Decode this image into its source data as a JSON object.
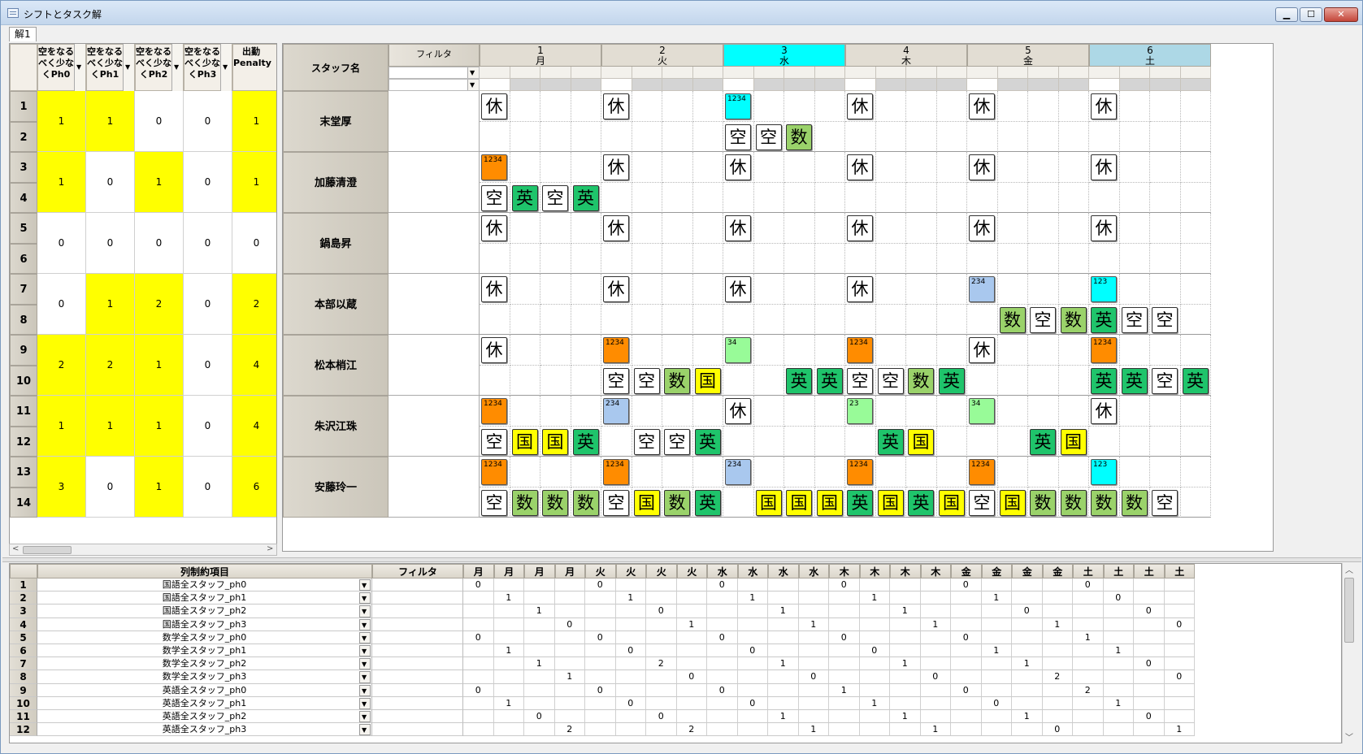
{
  "window": {
    "title": "シフトとタスク解",
    "min": "▁",
    "max": "☐",
    "close": "✕",
    "icons": [
      "app-icon",
      "minimize-icon",
      "maximize-icon",
      "close-icon"
    ]
  },
  "tabs": [
    {
      "label": "解1"
    }
  ],
  "left": {
    "headers": [
      "空をなるべく少なくPh0",
      "空をなるべく少なくPh1",
      "空をなるべく少なくPh2",
      "空をなるべく少なくPh3",
      "出勤Penalty"
    ],
    "rownums": [
      "1",
      "2",
      "3",
      "4",
      "5",
      "6",
      "7",
      "8",
      "9",
      "10",
      "11",
      "12",
      "13",
      "14"
    ],
    "groups": [
      {
        "vals": [
          "1",
          "1",
          "0",
          "0",
          "1"
        ],
        "yel": [
          true,
          true,
          false,
          false,
          true
        ]
      },
      {
        "vals": [
          "1",
          "0",
          "1",
          "0",
          "1"
        ],
        "yel": [
          true,
          false,
          true,
          false,
          true
        ]
      },
      {
        "vals": [
          "0",
          "0",
          "0",
          "0",
          "0"
        ],
        "yel": [
          false,
          false,
          false,
          false,
          false
        ]
      },
      {
        "vals": [
          "0",
          "1",
          "2",
          "0",
          "2"
        ],
        "yel": [
          false,
          true,
          true,
          false,
          true
        ]
      },
      {
        "vals": [
          "2",
          "2",
          "1",
          "0",
          "4"
        ],
        "yel": [
          true,
          true,
          true,
          false,
          true
        ]
      },
      {
        "vals": [
          "1",
          "1",
          "1",
          "0",
          "4"
        ],
        "yel": [
          true,
          true,
          true,
          false,
          true
        ]
      },
      {
        "vals": [
          "3",
          "0",
          "1",
          "0",
          "6"
        ],
        "yel": [
          true,
          false,
          true,
          false,
          true
        ]
      }
    ]
  },
  "right": {
    "staff_header": "スタッフ名",
    "filter_header": "フィルタ",
    "days": [
      {
        "n": "1",
        "d": "月",
        "color": "#e2ddd3"
      },
      {
        "n": "2",
        "d": "火",
        "color": "#e2ddd3"
      },
      {
        "n": "3",
        "d": "水",
        "color": "#00ffff"
      },
      {
        "n": "4",
        "d": "木",
        "color": "#e2ddd3"
      },
      {
        "n": "5",
        "d": "金",
        "color": "#e2ddd3"
      },
      {
        "n": "6",
        "d": "土",
        "color": "#add8e6"
      }
    ],
    "staff": [
      "末堂厚",
      "加藤清澄",
      "鍋島昇",
      "本部以蔵",
      "松本梢江",
      "朱沢江珠",
      "安藤玲一"
    ],
    "shifts": [
      [
        "休",
        "休",
        "1234:#00ffff",
        "休",
        "休",
        "休"
      ],
      [
        "1234:#ff8c00",
        "休",
        "休",
        "休",
        "休",
        "休"
      ],
      [
        "休",
        "休",
        "休",
        "休",
        "休",
        "休"
      ],
      [
        "休",
        "休",
        "休",
        "休",
        "234:#a9c8ee",
        "123:#00ffff"
      ],
      [
        "休",
        "1234:#ff8c00",
        "34:#98fb98",
        "1234:#ff8c00",
        "休",
        "1234:#ff8c00"
      ],
      [
        "1234:#ff8c00",
        "234:#a9c8ee",
        "休",
        "23:#98fb98",
        "34:#98fb98",
        "休"
      ],
      [
        "1234:#ff8c00",
        "1234:#ff8c00",
        "234:#a9c8ee",
        "1234:#ff8c00",
        "1234:#ff8c00",
        "123:#00ffff"
      ]
    ],
    "tasks": [
      [
        "",
        "",
        "",
        "",
        "",
        "",
        "",
        "",
        "空",
        "空",
        "数",
        "",
        "",
        "",
        "",
        "",
        "",
        "",
        "",
        "",
        "",
        "",
        "",
        ""
      ],
      [
        "空",
        "英",
        "空",
        "英",
        "",
        "",
        "",
        "",
        "",
        "",
        "",
        "",
        "",
        "",
        "",
        "",
        "",
        "",
        "",
        "",
        "",
        "",
        "",
        ""
      ],
      [
        "",
        "",
        "",
        "",
        "",
        "",
        "",
        "",
        "",
        "",
        "",
        "",
        "",
        "",
        "",
        "",
        "",
        "",
        "",
        "",
        "",
        "",
        "",
        ""
      ],
      [
        "",
        "",
        "",
        "",
        "",
        "",
        "",
        "",
        "",
        "",
        "",
        "",
        "",
        "",
        "",
        "",
        "",
        "数",
        "空",
        "数",
        "英",
        "空",
        "空",
        ""
      ],
      [
        "",
        "",
        "",
        "",
        "空",
        "空",
        "数",
        "国",
        "",
        "",
        "英",
        "英",
        "空",
        "空",
        "数",
        "英",
        "",
        "",
        "",
        "",
        "英",
        "英",
        "空",
        "英"
      ],
      [
        "空",
        "国",
        "国",
        "英",
        "",
        "空",
        "空",
        "英",
        "",
        "",
        "",
        "",
        "",
        "英",
        "国",
        "",
        "",
        "",
        "英",
        "国",
        "",
        "",
        "",
        ""
      ],
      [
        "空",
        "数",
        "数",
        "数",
        "空",
        "国",
        "数",
        "英",
        "",
        "国",
        "国",
        "国",
        "英",
        "国",
        "英",
        "国",
        "空",
        "国",
        "数",
        "数",
        "数",
        "数",
        "空",
        ""
      ]
    ],
    "task_colors": {
      "空": "#ffffff",
      "英": "#1fc46b",
      "数": "#9ad26a",
      "国": "#ffff00"
    },
    "chevron": "▼"
  },
  "bottom": {
    "col_header": "列制約項目",
    "filter_header": "フィルタ",
    "day_cols": [
      "月",
      "月",
      "月",
      "月",
      "火",
      "火",
      "火",
      "火",
      "水",
      "水",
      "水",
      "水",
      "木",
      "木",
      "木",
      "木",
      "金",
      "金",
      "金",
      "金",
      "土",
      "土",
      "土",
      "土"
    ],
    "rows": [
      {
        "n": "1",
        "label": "国語全スタッフ_ph0",
        "v": [
          "0",
          "",
          "",
          "",
          "0",
          "",
          "",
          "",
          "0",
          "",
          "",
          "",
          "0",
          "",
          "",
          "",
          "0",
          "",
          "",
          "",
          "0",
          "",
          "",
          ""
        ]
      },
      {
        "n": "2",
        "label": "国語全スタッフ_ph1",
        "v": [
          "",
          "1",
          "",
          "",
          "",
          "1",
          "",
          "",
          "",
          "1",
          "",
          "",
          "",
          "1",
          "",
          "",
          "",
          "1",
          "",
          "",
          "",
          "0",
          "",
          ""
        ]
      },
      {
        "n": "3",
        "label": "国語全スタッフ_ph2",
        "v": [
          "",
          "",
          "1",
          "",
          "",
          "",
          "0",
          "",
          "",
          "",
          "1",
          "",
          "",
          "",
          "1",
          "",
          "",
          "",
          "0",
          "",
          "",
          "",
          "0",
          ""
        ]
      },
      {
        "n": "4",
        "label": "国語全スタッフ_ph3",
        "v": [
          "",
          "",
          "",
          "0",
          "",
          "",
          "",
          "1",
          "",
          "",
          "",
          "1",
          "",
          "",
          "",
          "1",
          "",
          "",
          "",
          "1",
          "",
          "",
          "",
          "0"
        ]
      },
      {
        "n": "5",
        "label": "数学全スタッフ_ph0",
        "v": [
          "0",
          "",
          "",
          "",
          "0",
          "",
          "",
          "",
          "0",
          "",
          "",
          "",
          "0",
          "",
          "",
          "",
          "0",
          "",
          "",
          "",
          "1",
          "",
          "",
          ""
        ]
      },
      {
        "n": "6",
        "label": "数学全スタッフ_ph1",
        "v": [
          "",
          "1",
          "",
          "",
          "",
          "0",
          "",
          "",
          "",
          "0",
          "",
          "",
          "",
          "0",
          "",
          "",
          "",
          "1",
          "",
          "",
          "",
          "1",
          "",
          ""
        ]
      },
      {
        "n": "7",
        "label": "数学全スタッフ_ph2",
        "v": [
          "",
          "",
          "1",
          "",
          "",
          "",
          "2",
          "",
          "",
          "",
          "1",
          "",
          "",
          "",
          "1",
          "",
          "",
          "",
          "1",
          "",
          "",
          "",
          "0",
          ""
        ]
      },
      {
        "n": "8",
        "label": "数学全スタッフ_ph3",
        "v": [
          "",
          "",
          "",
          "1",
          "",
          "",
          "",
          "0",
          "",
          "",
          "",
          "0",
          "",
          "",
          "",
          "0",
          "",
          "",
          "",
          "2",
          "",
          "",
          "",
          "0"
        ]
      },
      {
        "n": "9",
        "label": "英語全スタッフ_ph0",
        "v": [
          "0",
          "",
          "",
          "",
          "0",
          "",
          "",
          "",
          "0",
          "",
          "",
          "",
          "1",
          "",
          "",
          "",
          "0",
          "",
          "",
          "",
          "2",
          "",
          "",
          ""
        ]
      },
      {
        "n": "10",
        "label": "英語全スタッフ_ph1",
        "v": [
          "",
          "1",
          "",
          "",
          "",
          "0",
          "",
          "",
          "",
          "0",
          "",
          "",
          "",
          "1",
          "",
          "",
          "",
          "0",
          "",
          "",
          "",
          "1",
          "",
          ""
        ]
      },
      {
        "n": "11",
        "label": "英語全スタッフ_ph2",
        "v": [
          "",
          "",
          "0",
          "",
          "",
          "",
          "0",
          "",
          "",
          "",
          "1",
          "",
          "",
          "",
          "1",
          "",
          "",
          "",
          "1",
          "",
          "",
          "",
          "0",
          ""
        ]
      },
      {
        "n": "12",
        "label": "英語全スタッフ_ph3",
        "v": [
          "",
          "",
          "",
          "2",
          "",
          "",
          "",
          "2",
          "",
          "",
          "",
          "1",
          "",
          "",
          "",
          "1",
          "",
          "",
          "",
          "0",
          "",
          "",
          "",
          "1"
        ]
      }
    ]
  },
  "scroll": {
    "left": "<",
    "right": ">",
    "up": "︿",
    "down": "﹀"
  }
}
